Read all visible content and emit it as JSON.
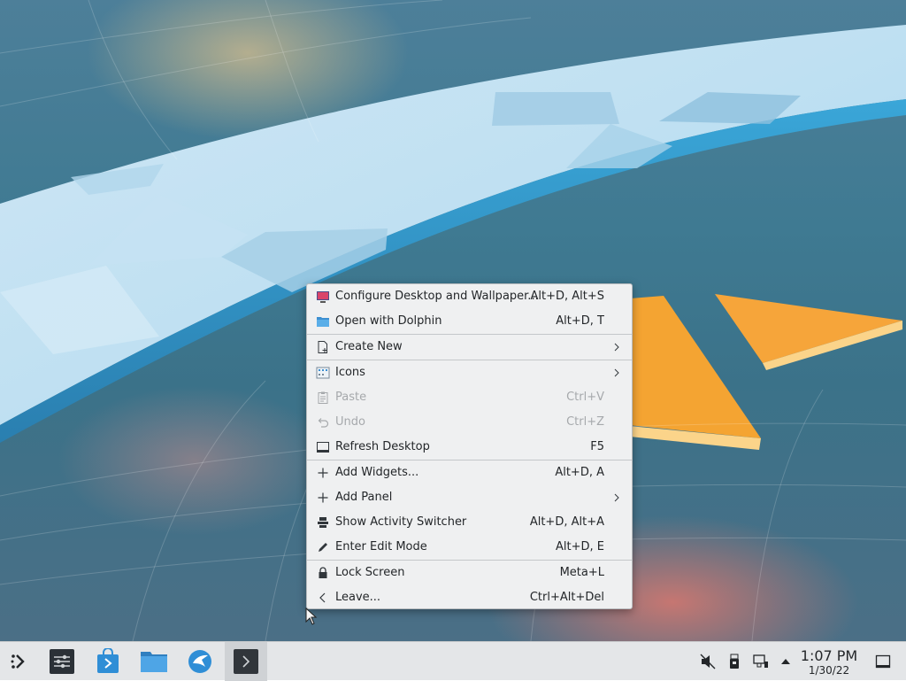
{
  "menu": {
    "items": [
      {
        "label": "Configure Desktop and Wallpaper...",
        "shortcut": "Alt+D, Alt+S",
        "icon": "configure-desktop-icon"
      },
      {
        "label": "Open with Dolphin",
        "shortcut": "Alt+D, T",
        "icon": "folder-icon"
      },
      {
        "label": "Create New",
        "shortcut": "",
        "icon": "new-document-icon",
        "submenu": true
      },
      {
        "label": "Icons",
        "shortcut": "",
        "icon": "icons-view-icon",
        "submenu": true
      },
      {
        "label": "Paste",
        "shortcut": "Ctrl+V",
        "icon": "paste-icon",
        "disabled": true
      },
      {
        "label": "Undo",
        "shortcut": "Ctrl+Z",
        "icon": "undo-icon",
        "disabled": true
      },
      {
        "label": "Refresh Desktop",
        "shortcut": "F5",
        "icon": "refresh-icon"
      },
      {
        "label": "Add Widgets...",
        "shortcut": "Alt+D, A",
        "icon": "plus-icon"
      },
      {
        "label": "Add Panel",
        "shortcut": "",
        "icon": "plus-icon",
        "submenu": true
      },
      {
        "label": "Show Activity Switcher",
        "shortcut": "Alt+D, Alt+A",
        "icon": "activities-icon"
      },
      {
        "label": "Enter Edit Mode",
        "shortcut": "Alt+D, E",
        "icon": "pencil-icon"
      },
      {
        "label": "Lock Screen",
        "shortcut": "Meta+L",
        "icon": "lock-icon"
      },
      {
        "label": "Leave...",
        "shortcut": "Ctrl+Alt+Del",
        "icon": "chevron-left-icon"
      }
    ]
  },
  "taskbar": {
    "apps": [
      "application-launcher-icon",
      "system-settings-icon",
      "discover-store-icon",
      "dolphin-folder-icon",
      "web-browser-icon",
      "konsole-terminal-icon"
    ],
    "tray": [
      "muted-volume-icon",
      "usb-device-icon",
      "network-icon",
      "expand-tray-icon"
    ],
    "clock": {
      "time": "1:07 PM",
      "date": "1/30/22"
    }
  },
  "colors": {
    "accent": "#3daee9",
    "menu_bg": "#eff0f1",
    "taskbar_bg": "#e4e6e8",
    "wallpaper_orange": "#f4a432"
  }
}
